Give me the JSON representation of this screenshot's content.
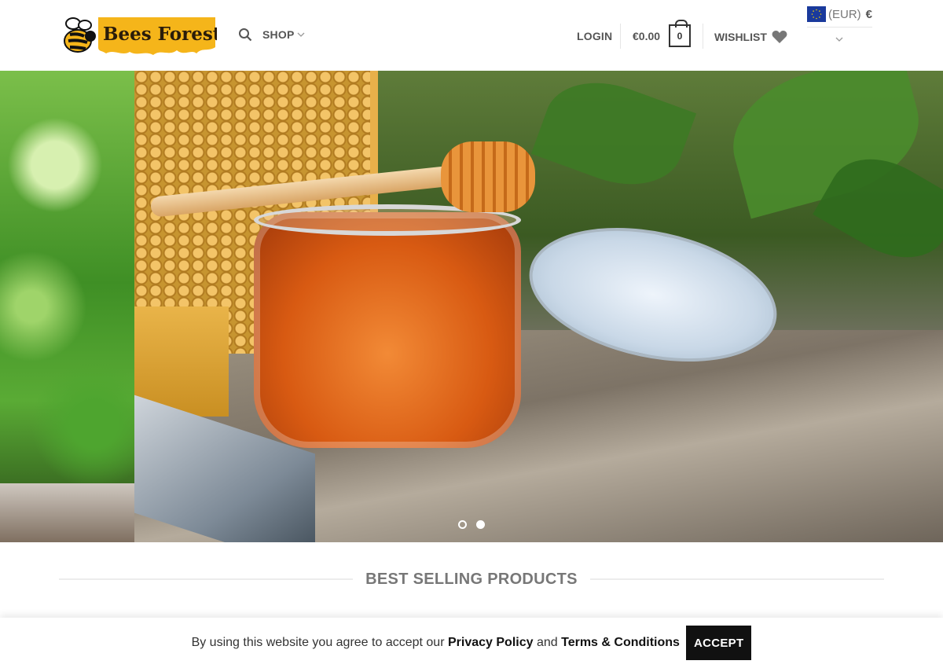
{
  "header": {
    "logo_text": "Bees Forest",
    "shop_label": "SHOP",
    "login_label": "LOGIN",
    "cart_total": "€0.00",
    "cart_count": "0",
    "wishlist_label": "WISHLIST",
    "currency_code": "(EUR)",
    "currency_symbol": "€"
  },
  "hero": {
    "slides": 2,
    "active_slide": 2
  },
  "section": {
    "title": "BEST SELLING PRODUCTS"
  },
  "cookie_bar": {
    "prefix": "By using this website you agree to accept our",
    "privacy_link": "Privacy Policy",
    "and_text": "and",
    "terms_link": "Terms & Conditions",
    "accept_label": "ACCEPT"
  },
  "colors": {
    "logo_yellow": "#f5b51a",
    "accent_dark": "#111111",
    "eu_blue": "#1a3a9c"
  }
}
